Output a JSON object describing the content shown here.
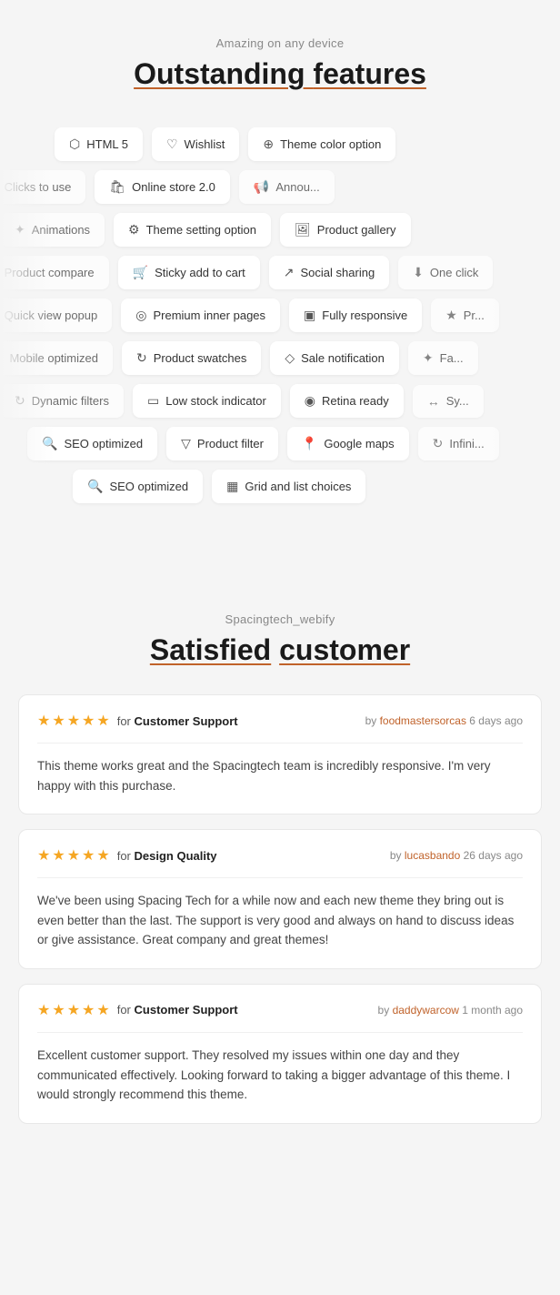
{
  "features": {
    "subtitle": "Amazing on any device",
    "title": "Outstanding",
    "title_accent": "features",
    "rows": [
      [
        {
          "icon": "◻",
          "label": "HTML 5"
        },
        {
          "icon": "♡",
          "label": "Wishlist"
        },
        {
          "icon": "⚙",
          "label": "Theme color option"
        }
      ],
      [
        {
          "icon": "🛍",
          "label": "Online store 2.0"
        },
        {
          "icon": "📢",
          "label": "Announcement bar"
        }
      ],
      [
        {
          "icon": "◻",
          "label": "Clicks to use"
        },
        {
          "icon": "⚙",
          "label": "Theme setting option"
        },
        {
          "icon": "🖼",
          "label": "Product gallery"
        }
      ],
      [
        {
          "icon": "✦",
          "label": "Animations"
        },
        {
          "icon": "🛒",
          "label": "Sticky add to cart"
        },
        {
          "icon": "↗",
          "label": "Social sharing"
        },
        {
          "icon": "⬇",
          "label": "One click"
        }
      ],
      [
        {
          "icon": "◻",
          "label": "Product compare"
        },
        {
          "icon": "◎",
          "label": "Premium inner pages"
        },
        {
          "icon": "▣",
          "label": "Fully responsive"
        },
        {
          "icon": "★",
          "label": "Pr..."
        }
      ],
      [
        {
          "icon": "◻",
          "label": "Quick view popup"
        },
        {
          "icon": "↻",
          "label": "Product swatches"
        },
        {
          "icon": "◇",
          "label": "Sale notification"
        },
        {
          "icon": "✦",
          "label": "Fa..."
        }
      ],
      [
        {
          "icon": "◻",
          "label": "Mobile optimized"
        },
        {
          "icon": "▭",
          "label": "Low stock indicator"
        },
        {
          "icon": "◉",
          "label": "Retina ready"
        },
        {
          "icon": "↔",
          "label": "Sy..."
        }
      ],
      [
        {
          "icon": "↻",
          "label": "Dynamic filters"
        },
        {
          "icon": "▽",
          "label": "Product filter"
        },
        {
          "icon": "📍",
          "label": "Google maps"
        },
        {
          "icon": "↻",
          "label": "Infini..."
        }
      ],
      [
        {
          "icon": "🔍",
          "label": "SEO optimized"
        },
        {
          "icon": "▦",
          "label": "Grid and list choices"
        }
      ]
    ]
  },
  "reviews": {
    "subtitle": "Spacingtech_webify",
    "title": "Satisfied",
    "title_accent": "customer",
    "items": [
      {
        "rating": 5,
        "for_label": "for",
        "category": "Customer Support",
        "by_label": "by",
        "author": "foodmastersorcas",
        "time": "6 days ago",
        "body": "This theme works great and the Spacingtech team is incredibly responsive. I'm very happy with this purchase."
      },
      {
        "rating": 5,
        "for_label": "for",
        "category": "Design Quality",
        "by_label": "by",
        "author": "lucasbando",
        "time": "26 days ago",
        "body": "We've been using Spacing Tech for a while now and each new theme they bring out is even better than the last. The support is very good and always on hand to discuss ideas or give assistance. Great company and great themes!"
      },
      {
        "rating": 5,
        "for_label": "for",
        "category": "Customer Support",
        "by_label": "by",
        "author": "daddywarcow",
        "time": "1 month ago",
        "body": "Excellent customer support. They resolved my issues within one day and they communicated effectively. Looking forward to taking a bigger advantage of this theme. I would strongly recommend this theme."
      }
    ]
  }
}
